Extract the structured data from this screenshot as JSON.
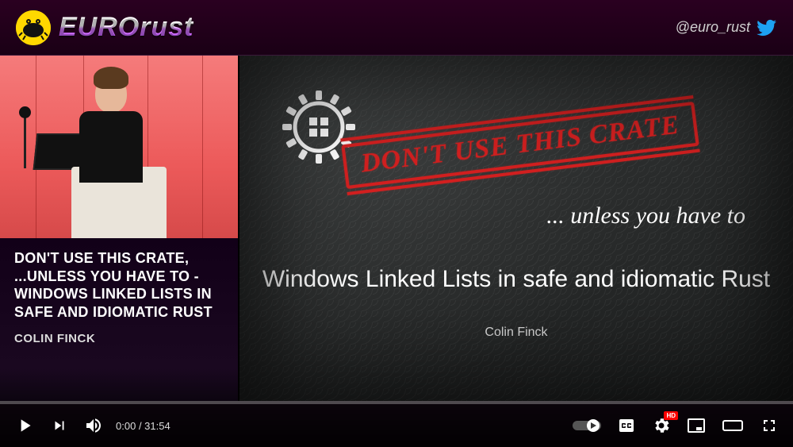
{
  "header": {
    "brand": "EUROrust",
    "twitter_handle": "@euro_rust"
  },
  "session": {
    "title": "DON'T USE THIS CRATE, ...UNLESS YOU HAVE TO - WINDOWS LINKED LISTS IN SAFE AND IDIOMATIC RUST",
    "speaker": "COLIN FINCK"
  },
  "slide": {
    "stamp": "DON'T USE THIS CRATE",
    "unless": "... unless you have to",
    "title": "Windows Linked Lists in safe and idiomatic Rust",
    "author": "Colin Finck"
  },
  "player": {
    "current_time": "0:00",
    "duration": "31:54",
    "hd_label": "HD",
    "progress_percent": 0
  }
}
